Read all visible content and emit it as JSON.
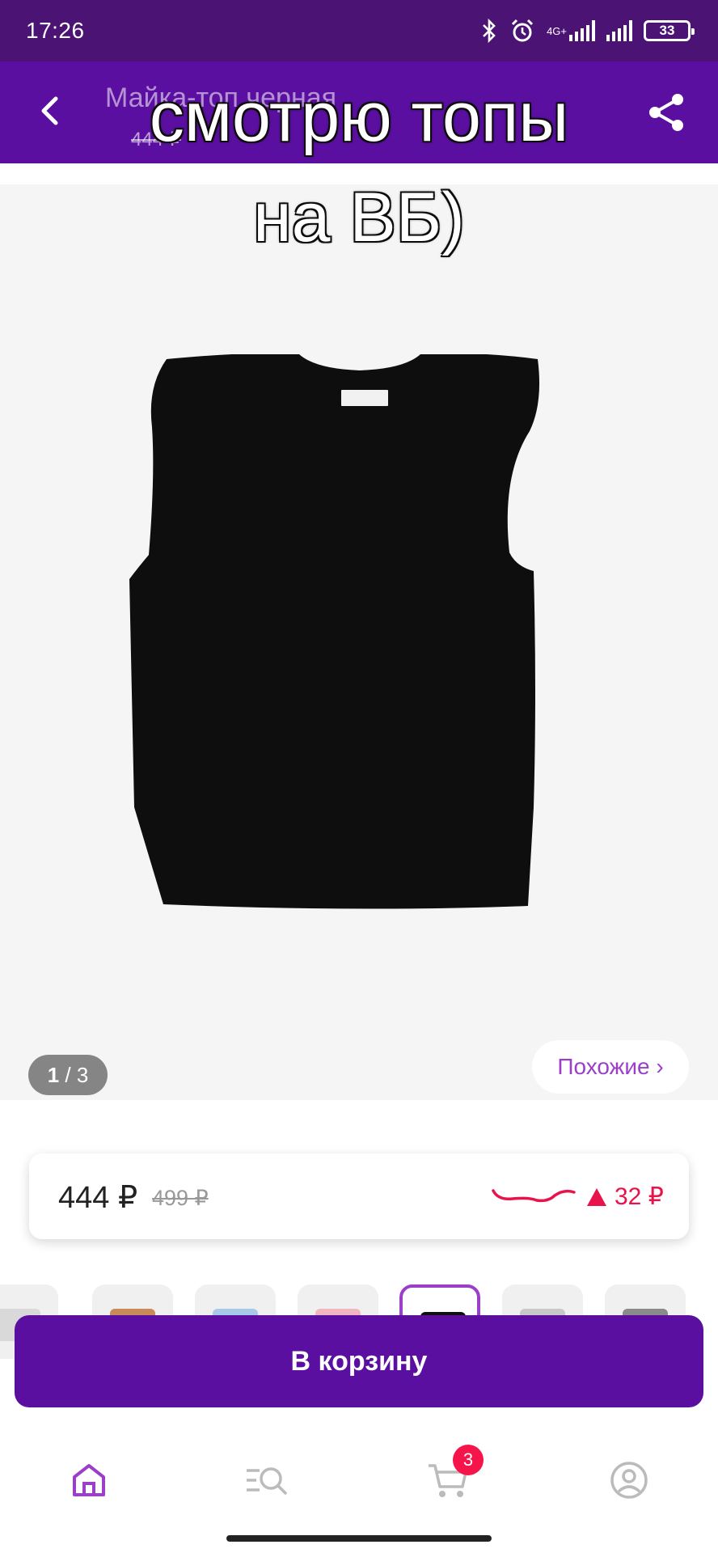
{
  "status_bar": {
    "time": "17:26",
    "network_label": "4G+",
    "battery_level": "33",
    "icons": [
      "bluetooth-icon",
      "alarm-icon",
      "signal-icon",
      "signal-icon",
      "battery-icon"
    ]
  },
  "header": {
    "title": "Майка-топ черная",
    "price": "444 ₽",
    "back_icon": "back-arrow-icon",
    "share_icon": "share-icon"
  },
  "caption": {
    "line1": "смотрю топы",
    "line2": "на ВБ)"
  },
  "gallery": {
    "current": "1",
    "separator": " / ",
    "total": "3",
    "similar_label": "Похожие ›",
    "background": "#f5f5f5"
  },
  "price_card": {
    "price": "444 ₽",
    "old_price": "499 ₽",
    "change": "32 ₽",
    "trend_direction": "up",
    "accent_color": "#e8134a"
  },
  "thumbnails": [
    {
      "color": "#d9d9d9",
      "selected": false
    },
    {
      "color": "#c98a5a",
      "selected": false
    },
    {
      "color": "#a9c9e8",
      "selected": false
    },
    {
      "color": "#f2b6c2",
      "selected": false
    },
    {
      "color": "#111111",
      "selected": true
    },
    {
      "color": "#c8c8c8",
      "selected": false
    },
    {
      "color": "#8a8a8a",
      "selected": false
    }
  ],
  "actions": {
    "add_to_cart": "В корзину"
  },
  "bottom_nav": {
    "items": [
      "home-icon",
      "catalog-search-icon",
      "cart-icon",
      "profile-icon"
    ],
    "cart_badge": "3"
  },
  "colors": {
    "brand": "#5a0fa0",
    "status_bar": "#4a1374",
    "accent_purple": "#9b3fc8"
  }
}
